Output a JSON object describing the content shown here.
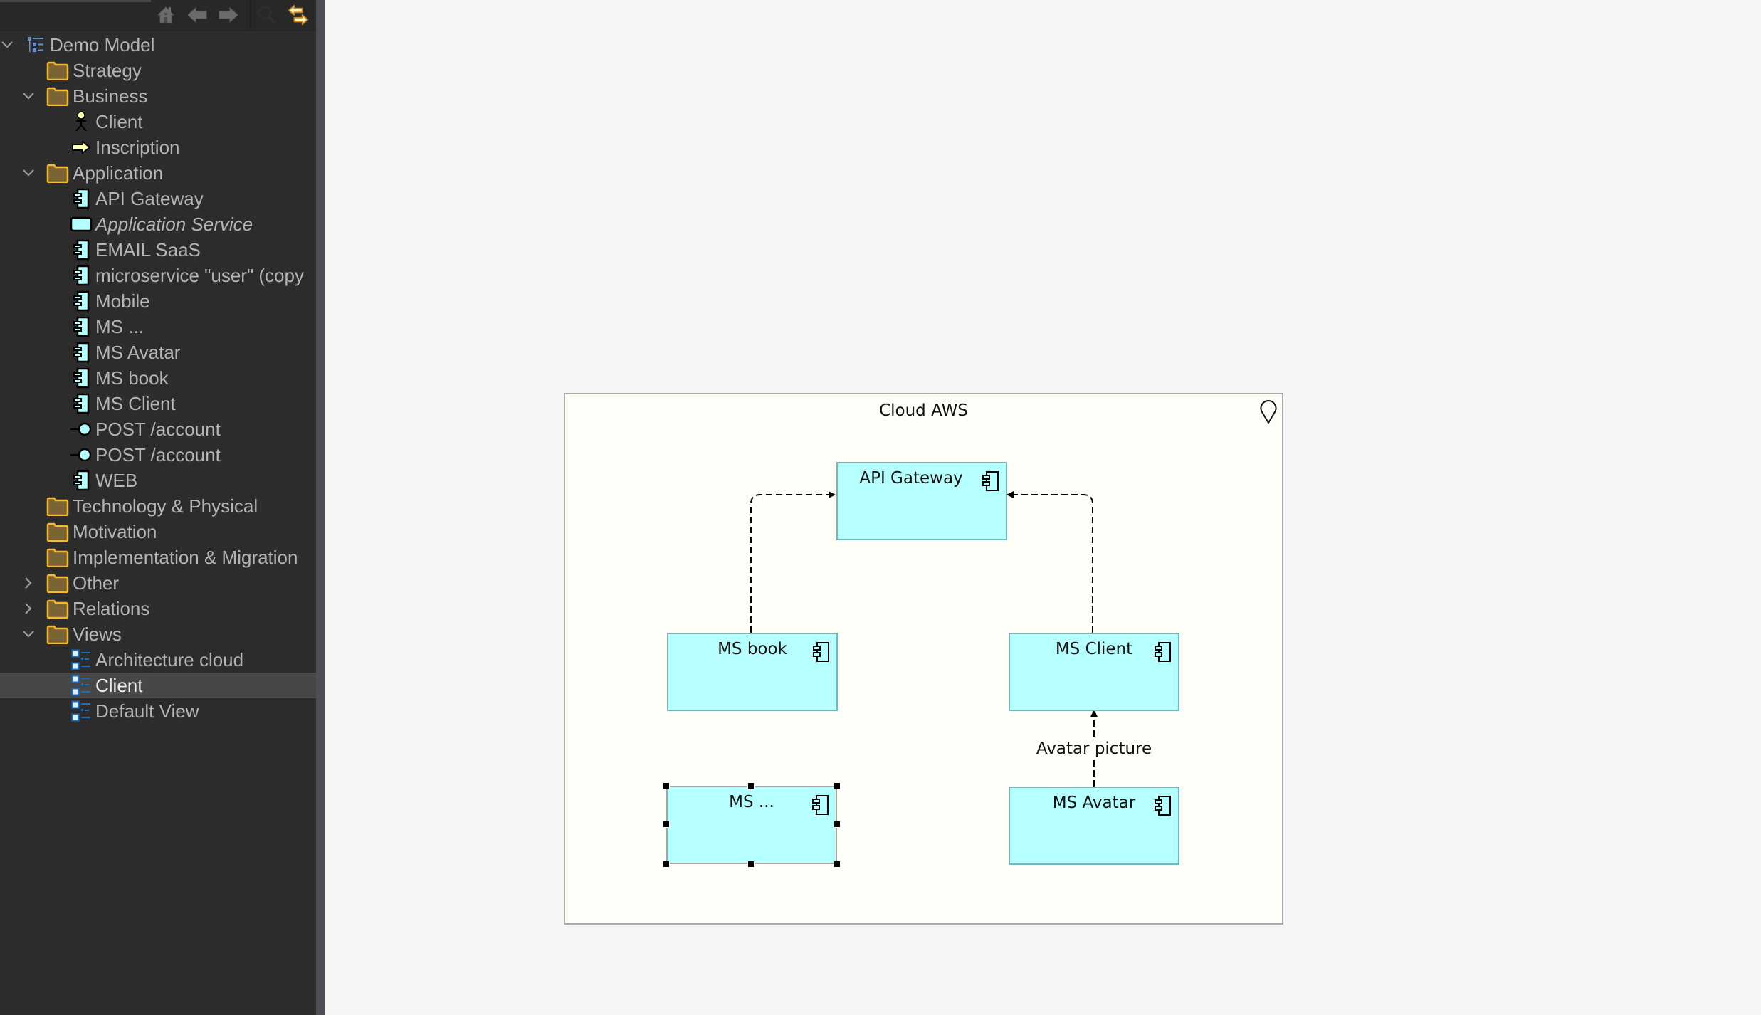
{
  "toolbar": {
    "buttons": [
      {
        "name": "home-icon",
        "enabled": false
      },
      {
        "name": "back-arrow-icon",
        "enabled": false
      },
      {
        "name": "forward-arrow-icon",
        "enabled": false
      },
      {
        "name": "search-icon",
        "enabled": false
      },
      {
        "name": "link-to-editor-icon",
        "enabled": true
      }
    ]
  },
  "tree": {
    "items": [
      {
        "label": "Demo Model",
        "level": 0,
        "chevron": "expanded",
        "icon": "model-tree-icon"
      },
      {
        "label": "Strategy",
        "level": 1,
        "chevron": "none",
        "icon": "folder-icon"
      },
      {
        "label": "Business",
        "level": 1,
        "chevron": "expanded",
        "icon": "folder-icon"
      },
      {
        "label": "Client",
        "level": 2,
        "chevron": "none",
        "icon": "business-actor-icon"
      },
      {
        "label": "Inscription",
        "level": 2,
        "chevron": "none",
        "icon": "business-event-arrow-icon"
      },
      {
        "label": "Application",
        "level": 1,
        "chevron": "expanded",
        "icon": "folder-icon"
      },
      {
        "label": "API Gateway",
        "level": 2,
        "chevron": "none",
        "icon": "application-component-icon"
      },
      {
        "label": "Application Service",
        "level": 2,
        "chevron": "none",
        "icon": "application-service-icon",
        "italic": true
      },
      {
        "label": "EMAIL SaaS",
        "level": 2,
        "chevron": "none",
        "icon": "application-component-icon"
      },
      {
        "label": "microservice \"user\" (copy",
        "level": 2,
        "chevron": "none",
        "icon": "application-component-icon"
      },
      {
        "label": "Mobile",
        "level": 2,
        "chevron": "none",
        "icon": "application-component-icon"
      },
      {
        "label": "MS ...",
        "level": 2,
        "chevron": "none",
        "icon": "application-component-icon"
      },
      {
        "label": "MS Avatar",
        "level": 2,
        "chevron": "none",
        "icon": "application-component-icon"
      },
      {
        "label": "MS book",
        "level": 2,
        "chevron": "none",
        "icon": "application-component-icon"
      },
      {
        "label": "MS Client",
        "level": 2,
        "chevron": "none",
        "icon": "application-component-icon"
      },
      {
        "label": "POST /account",
        "level": 2,
        "chevron": "none",
        "icon": "application-interface-icon"
      },
      {
        "label": "POST /account",
        "level": 2,
        "chevron": "none",
        "icon": "application-interface-icon"
      },
      {
        "label": "WEB",
        "level": 2,
        "chevron": "none",
        "icon": "application-component-icon"
      },
      {
        "label": "Technology & Physical",
        "level": 1,
        "chevron": "none",
        "icon": "folder-icon"
      },
      {
        "label": "Motivation",
        "level": 1,
        "chevron": "none",
        "icon": "folder-icon"
      },
      {
        "label": "Implementation & Migration",
        "level": 1,
        "chevron": "none",
        "icon": "folder-icon"
      },
      {
        "label": "Other",
        "level": 1,
        "chevron": "collapsed",
        "icon": "folder-icon"
      },
      {
        "label": "Relations",
        "level": 1,
        "chevron": "collapsed",
        "icon": "folder-icon"
      },
      {
        "label": "Views",
        "level": 1,
        "chevron": "expanded",
        "icon": "folder-icon"
      },
      {
        "label": "Architecture cloud",
        "level": 2,
        "chevron": "none",
        "icon": "diagram-view-icon"
      },
      {
        "label": "Client",
        "level": 2,
        "chevron": "none",
        "icon": "diagram-view-icon",
        "selected": true
      },
      {
        "label": "Default View",
        "level": 2,
        "chevron": "none",
        "icon": "diagram-view-icon"
      }
    ]
  },
  "diagram": {
    "group": {
      "title": "Cloud AWS",
      "icon": "location-pin-icon"
    },
    "nodes": {
      "api_gateway": {
        "title": "API Gateway",
        "icon": "application-component-icon"
      },
      "ms_book": {
        "title": "MS book",
        "icon": "application-component-icon"
      },
      "ms_client": {
        "title": "MS Client",
        "icon": "application-component-icon"
      },
      "ms_dots": {
        "title": "MS ...",
        "icon": "application-component-icon",
        "selected": true
      },
      "ms_avatar": {
        "title": "MS Avatar",
        "icon": "application-component-icon"
      }
    },
    "connections": [
      {
        "from": "MS book",
        "to": "API Gateway",
        "style": "dashed",
        "label": ""
      },
      {
        "from": "MS Client",
        "to": "API Gateway",
        "style": "dashed",
        "label": ""
      },
      {
        "from": "MS Avatar",
        "to": "MS Client",
        "style": "dashed",
        "label": "Avatar picture"
      }
    ]
  },
  "colors": {
    "component_fill": "#b5ffff",
    "component_border": "#78b4ba",
    "group_fill": "#fdfef8",
    "folder": "#f5b82e",
    "selection_row": "#474747"
  }
}
